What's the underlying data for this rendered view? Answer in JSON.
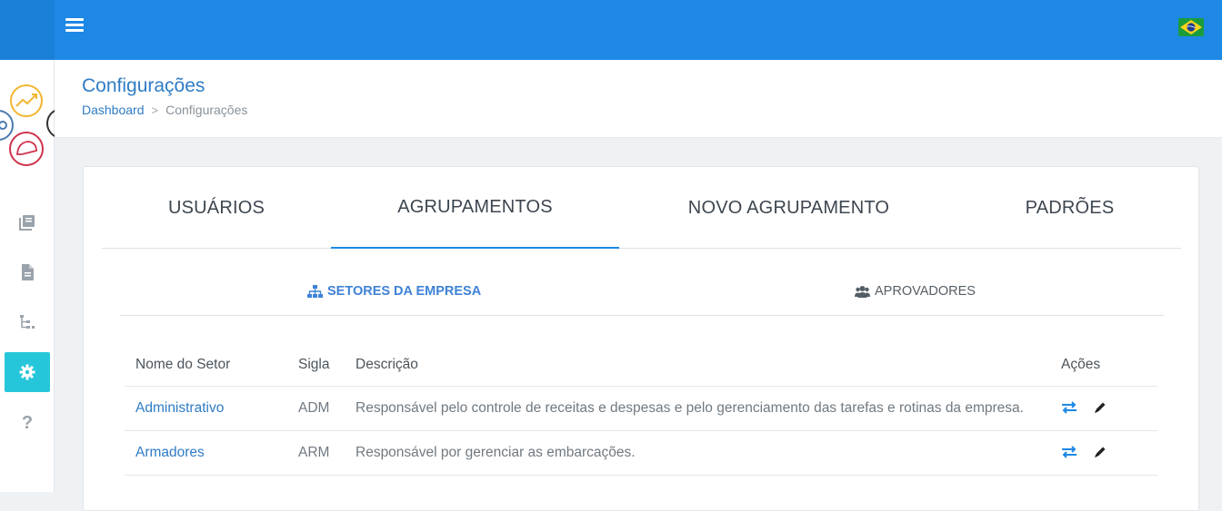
{
  "header": {
    "menu_icon": "hamburger-menu-icon",
    "flag_icon": "brazil-flag-icon",
    "brand_color": "#1e88e5"
  },
  "sidebar": {
    "items": [
      {
        "icon": "book-stack-icon"
      },
      {
        "icon": "document-icon"
      },
      {
        "icon": "tree-hierarchy-icon"
      },
      {
        "icon": "gear-icon",
        "active": true
      },
      {
        "icon": "help-icon",
        "label": "?"
      }
    ]
  },
  "page": {
    "title": "Configurações",
    "breadcrumb": {
      "home": "Dashboard",
      "separator": ">",
      "current": "Configurações"
    }
  },
  "tabs": [
    {
      "label": "USUÁRIOS"
    },
    {
      "label": "AGRUPAMENTOS",
      "active": true
    },
    {
      "label": "NOVO AGRUPAMENTO"
    },
    {
      "label": "PADRÕES"
    }
  ],
  "subtabs": [
    {
      "label": "SETORES DA EMPRESA",
      "icon": "sitemap-icon",
      "active": true
    },
    {
      "label": "APROVADORES",
      "icon": "users-icon"
    }
  ],
  "table": {
    "headers": {
      "name": "Nome do Setor",
      "sigla": "Sigla",
      "description": "Descrição",
      "actions": "Ações"
    },
    "rows": [
      {
        "name": "Administrativo",
        "sigla": "ADM",
        "description": "Responsável pelo controle de receitas e despesas e pelo gerenciamento das tarefas e rotinas da empresa."
      },
      {
        "name": "Armadores",
        "sigla": "ARM",
        "description": "Responsável por gerenciar as embarcações."
      }
    ]
  }
}
